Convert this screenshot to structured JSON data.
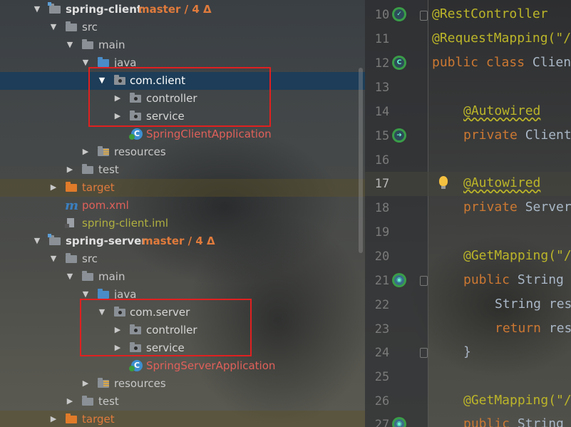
{
  "project_tree": {
    "client_module": {
      "name": "spring-client",
      "vcs": "master / 4 Δ",
      "src": "src",
      "main": "main",
      "java": "java",
      "package": "com.client",
      "controller": "controller",
      "service": "service",
      "app_class": "SpringClientApplication",
      "resources": "resources",
      "test": "test",
      "target": "target",
      "pom": "pom.xml",
      "iml": "spring-client.iml"
    },
    "server_module": {
      "name": "spring-server",
      "vcs": "master / 4 Δ",
      "src": "src",
      "main": "main",
      "java": "java",
      "package": "com.server",
      "controller": "controller",
      "service": "service",
      "app_class": "SpringServerApplication",
      "resources": "resources",
      "test": "test",
      "target": "target"
    }
  },
  "editor": {
    "lines": [
      {
        "num": "10",
        "text": "@RestController"
      },
      {
        "num": "11",
        "text": "@RequestMapping(\"/"
      },
      {
        "num": "12",
        "kw": "public class ",
        "text": "Clien"
      },
      {
        "num": "13",
        "text": ""
      },
      {
        "num": "14",
        "text": "@Autowired"
      },
      {
        "num": "15",
        "kw": "private ",
        "text": "Client"
      },
      {
        "num": "16",
        "text": ""
      },
      {
        "num": "17",
        "text": "@Autowired"
      },
      {
        "num": "18",
        "kw": "private ",
        "text": "Server"
      },
      {
        "num": "19",
        "text": ""
      },
      {
        "num": "20",
        "text": "@GetMapping(\"/"
      },
      {
        "num": "21",
        "kw": "public ",
        "text": "String "
      },
      {
        "num": "22",
        "text": "String res"
      },
      {
        "num": "23",
        "kw": "return ",
        "text": "res"
      },
      {
        "num": "24",
        "text": "}"
      },
      {
        "num": "25",
        "text": ""
      },
      {
        "num": "26",
        "text": "@GetMapping(\"/"
      },
      {
        "num": "27",
        "kw": "public ",
        "text": "String "
      }
    ]
  },
  "colors": {
    "selection": "#1d3d58",
    "highlight_box": "#e02020",
    "vcs_branch": "#e07b3c",
    "excluded": "#e07b3c",
    "untracked": "#e0605a",
    "ignored": "#b0b040",
    "annotation": "#bbb529",
    "keyword": "#cc7832"
  },
  "icons": [
    "folder-icon",
    "source-folder-icon",
    "package-icon",
    "resources-folder-icon",
    "excluded-folder-icon",
    "spring-boot-app-icon",
    "maven-icon",
    "iml-file-icon",
    "spring-bean-gutter-icon",
    "run-gutter-icon",
    "lightbulb-icon",
    "fold-marker-icon"
  ]
}
